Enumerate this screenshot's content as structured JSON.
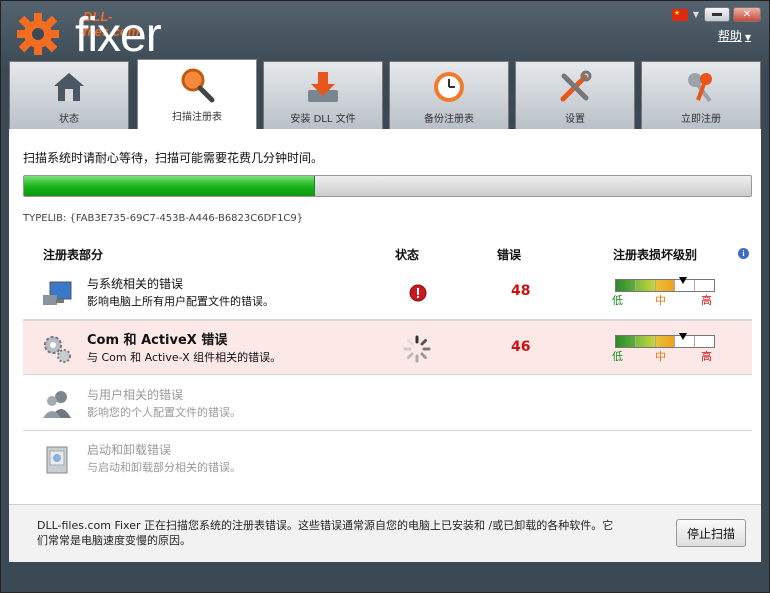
{
  "brand": {
    "small": "DLL-files.com",
    "big": "fixer"
  },
  "header": {
    "help_label": "帮助"
  },
  "tabs": [
    {
      "label": "状态",
      "icon": "home-icon"
    },
    {
      "label": "扫描注册表",
      "icon": "magnifier-icon",
      "active": true
    },
    {
      "label": "安装 DLL 文件",
      "icon": "install-dll-icon"
    },
    {
      "label": "备份注册表",
      "icon": "clock-backup-icon"
    },
    {
      "label": "设置",
      "icon": "tools-icon"
    },
    {
      "label": "立即注册",
      "icon": "keys-icon"
    }
  ],
  "scan": {
    "message": "扫描系统时请耐心等待，扫描可能需要花费几分钟时间。",
    "progress_fraction": 0.4,
    "current_item": "TYPELIB: {FAB3E735-69C7-453B-A446-B6823C6DF1C9}"
  },
  "table": {
    "headers": {
      "section": "注册表部分",
      "status": "状态",
      "errors": "错误",
      "severity": "注册表损坏级别"
    },
    "rows": [
      {
        "title": "与系统相关的错误",
        "desc": "影响电脑上所有用户配置文件的错误。",
        "status": "error",
        "errors": "48",
        "severity_fraction": 0.68
      },
      {
        "title": "Com 和  ActiveX 错误",
        "desc": "与  Com 和  Active-X 组件相关的错误。",
        "status": "scanning",
        "errors": "46",
        "severity_fraction": 0.68
      },
      {
        "title": "与用户相关的错误",
        "desc": "影响您的个人配置文件的错误。"
      },
      {
        "title": "启动和卸载错误",
        "desc": "与启动和卸载部分相关的错误。"
      }
    ],
    "severity_labels": {
      "low": "低",
      "mid": "中",
      "high": "高"
    }
  },
  "footer": {
    "text": "DLL-files.com Fixer 正在扫描您系统的注册表错误。这些错误通常源自您的电脑上已安装和  /或已卸载的各种软件。它们常常是电脑速度变慢的原因。",
    "stop_button": "停止扫描"
  },
  "colors": {
    "accent": "#f26c21",
    "progress": "#1cb51c",
    "error": "#cc1111"
  }
}
